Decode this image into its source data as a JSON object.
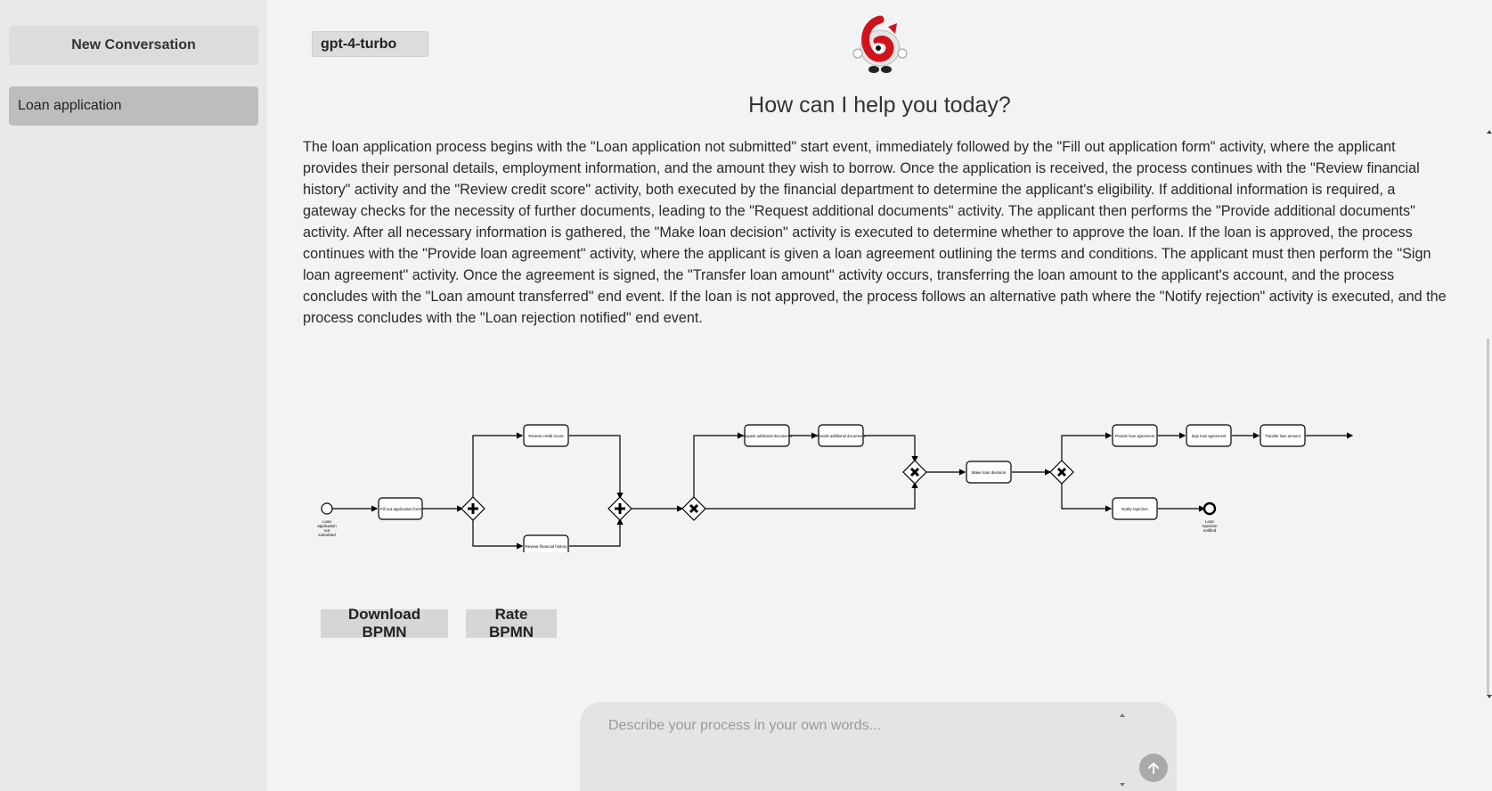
{
  "sidebar": {
    "new_conversation_label": "New Conversation",
    "conversations": [
      {
        "label": "Loan application"
      }
    ]
  },
  "header": {
    "model_selected": "gpt-4-turbo",
    "greeting": "How can I help you today?"
  },
  "message": {
    "text": "The loan application process begins with the \"Loan application not submitted\" start event, immediately followed by the \"Fill out application form\" activity, where the applicant provides their personal details, employment information, and the amount they wish to borrow. Once the application is received, the process continues with the \"Review financial history\" activity and the \"Review credit score\" activity, both executed by the financial department to determine the applicant's eligibility. If additional information is required, a gateway checks for the necessity of further documents, leading to the \"Request additional documents\" activity. The applicant then performs the \"Provide additional documents\" activity. After all necessary information is gathered, the \"Make loan decision\" activity is executed to determine whether to approve the loan. If the loan is approved, the process continues with the \"Provide loan agreement\" activity, where the applicant is given a loan agreement outlining the terms and conditions. The applicant must then perform the \"Sign loan agreement\" activity. Once the agreement is signed, the \"Transfer loan amount\" activity occurs, transferring the loan amount to the applicant's account, and the process concludes with the \"Loan amount transferred\" end event. If the loan is not approved, the process follows an alternative path where the \"Notify rejection\" activity is executed, and the process concludes with the \"Loan rejection notified\" end event."
  },
  "bpmn": {
    "start_event": "Loan application not submitted",
    "end_rejection": "Loan rejection notified",
    "tasks": {
      "fill_form": "Fill out application form",
      "review_credit": "Review credit score",
      "review_financial": "Review financial history",
      "request_docs": "Request additional documents",
      "provide_docs": "Provide additional documents",
      "make_decision": "Make loan decision",
      "provide_agreement": "Provide loan agreement",
      "sign_agreement": "Sign loan agreement",
      "transfer_amount": "Transfer loan amount",
      "notify_rejection": "Notify rejection"
    }
  },
  "actions": {
    "download_label": "Download BPMN",
    "rate_label": "Rate BPMN"
  },
  "composer": {
    "placeholder": "Describe your process in your own words..."
  }
}
